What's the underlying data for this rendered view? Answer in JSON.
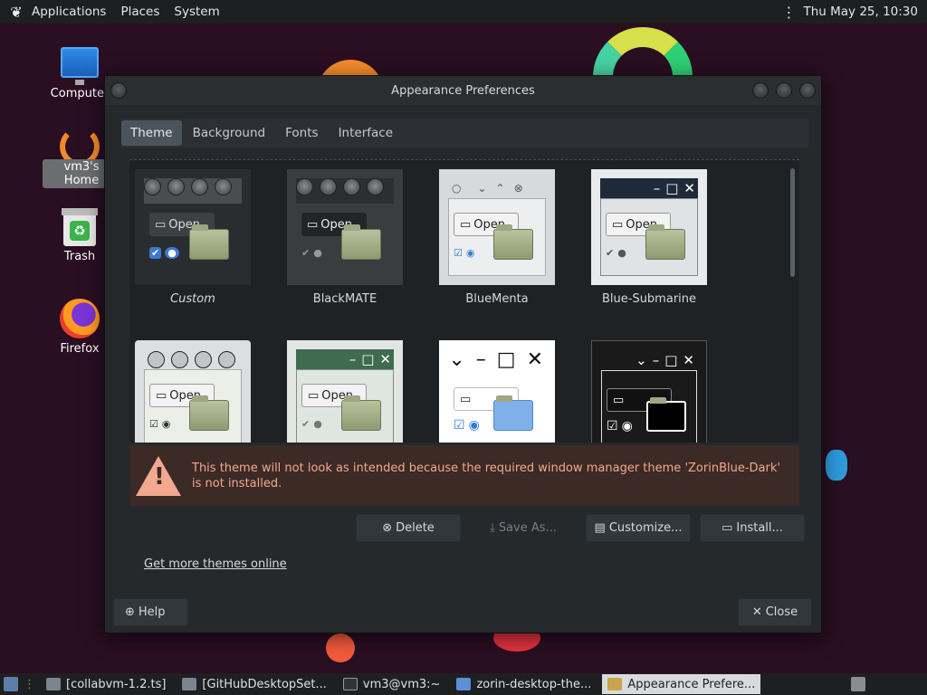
{
  "top_panel": {
    "menus": [
      "Applications",
      "Places",
      "System"
    ],
    "clock": "Thu May 25, 10:30"
  },
  "desktop": {
    "icons": [
      "Computer",
      "vm3's Home",
      "Trash",
      "Firefox"
    ]
  },
  "window": {
    "title": "Appearance Preferences",
    "tabs": [
      "Theme",
      "Background",
      "Fonts",
      "Interface"
    ],
    "active_tab": "Theme",
    "themes": [
      {
        "name": "Custom"
      },
      {
        "name": "BlackMATE"
      },
      {
        "name": "BlueMenta"
      },
      {
        "name": "Blue-Submarine"
      },
      {
        "name": ""
      },
      {
        "name": ""
      },
      {
        "name": ""
      },
      {
        "name": ""
      }
    ],
    "thumb_open_label": "Open",
    "warning": "This theme will not look as intended because the required window manager theme 'ZorinBlue-Dark' is not installed.",
    "buttons": {
      "delete": "Delete",
      "save_as": "Save As...",
      "customize": "Customize...",
      "install": "Install..."
    },
    "more_link": "Get more themes online",
    "help": "Help",
    "close": "Close"
  },
  "taskbar": {
    "tasks": [
      "[collabvm-1.2.ts]",
      "[GitHubDesktopSet...",
      "vm3@vm3:~",
      "zorin-desktop-the...",
      "Appearance Prefere..."
    ]
  },
  "colors": {
    "window_bg": "#25292c",
    "warning_text": "#f2a98e",
    "warning_bg": "#3b2a26",
    "active_tab": "#4b545b"
  }
}
